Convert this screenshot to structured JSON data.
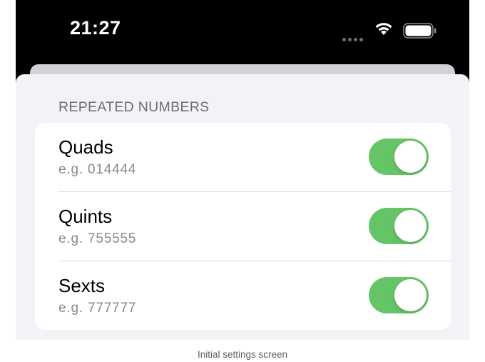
{
  "status_bar": {
    "time": "21:27",
    "wifi_icon": "wifi-icon",
    "battery_icon": "battery-icon"
  },
  "settings": {
    "section_header": "REPEATED NUMBERS",
    "rows": [
      {
        "title": "Quads",
        "subtitle": "e.g. 014444",
        "enabled": true
      },
      {
        "title": "Quints",
        "subtitle": "e.g. 755555",
        "enabled": true
      },
      {
        "title": "Sexts",
        "subtitle": "e.g. 777777",
        "enabled": true
      }
    ]
  },
  "colors": {
    "toggle_on": "#65c466",
    "sheet_bg": "#f2f2f7"
  },
  "caption": "Initial settings screen"
}
